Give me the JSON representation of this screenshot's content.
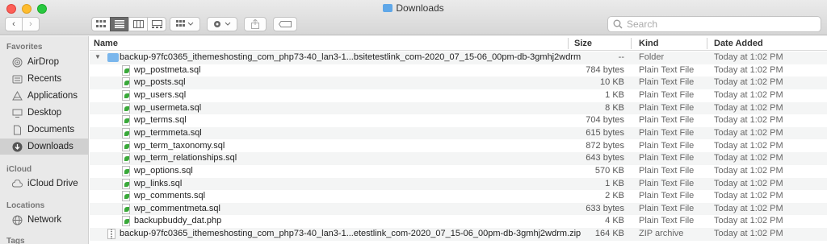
{
  "window": {
    "title": "Downloads"
  },
  "toolbar": {
    "back_glyph": "‹",
    "forward_glyph": "›",
    "search_placeholder": "Search"
  },
  "sidebar": {
    "favorites_heading": "Favorites",
    "favorites": [
      {
        "label": "AirDrop",
        "icon": "airdrop-icon"
      },
      {
        "label": "Recents",
        "icon": "recents-icon"
      },
      {
        "label": "Applications",
        "icon": "applications-icon"
      },
      {
        "label": "Desktop",
        "icon": "desktop-icon"
      },
      {
        "label": "Documents",
        "icon": "documents-icon"
      },
      {
        "label": "Downloads",
        "icon": "downloads-icon",
        "selected": true
      }
    ],
    "icloud_heading": "iCloud",
    "icloud": [
      {
        "label": "iCloud Drive",
        "icon": "cloud-icon"
      }
    ],
    "locations_heading": "Locations",
    "locations": [
      {
        "label": "Network",
        "icon": "network-icon"
      }
    ],
    "tags_heading": "Tags"
  },
  "columns": {
    "name": "Name",
    "size": "Size",
    "kind": "Kind",
    "date": "Date Added"
  },
  "rows": [
    {
      "name": "backup-97fc0365_ithemeshosting_com_php73-40_lan3-1...bsitetestlink_com-2020_07_15-06_00pm-db-3gmhj2wdrm",
      "size": "--",
      "kind": "Folder",
      "date": "Today at 1:02 PM",
      "type": "folder",
      "expanded": true
    },
    {
      "name": "wp_postmeta.sql",
      "size": "784 bytes",
      "kind": "Plain Text File",
      "date": "Today at 1:02 PM",
      "type": "sql"
    },
    {
      "name": "wp_posts.sql",
      "size": "10 KB",
      "kind": "Plain Text File",
      "date": "Today at 1:02 PM",
      "type": "sql"
    },
    {
      "name": "wp_users.sql",
      "size": "1 KB",
      "kind": "Plain Text File",
      "date": "Today at 1:02 PM",
      "type": "sql"
    },
    {
      "name": "wp_usermeta.sql",
      "size": "8 KB",
      "kind": "Plain Text File",
      "date": "Today at 1:02 PM",
      "type": "sql"
    },
    {
      "name": "wp_terms.sql",
      "size": "704 bytes",
      "kind": "Plain Text File",
      "date": "Today at 1:02 PM",
      "type": "sql"
    },
    {
      "name": "wp_termmeta.sql",
      "size": "615 bytes",
      "kind": "Plain Text File",
      "date": "Today at 1:02 PM",
      "type": "sql"
    },
    {
      "name": "wp_term_taxonomy.sql",
      "size": "872 bytes",
      "kind": "Plain Text File",
      "date": "Today at 1:02 PM",
      "type": "sql"
    },
    {
      "name": "wp_term_relationships.sql",
      "size": "643 bytes",
      "kind": "Plain Text File",
      "date": "Today at 1:02 PM",
      "type": "sql"
    },
    {
      "name": "wp_options.sql",
      "size": "570 KB",
      "kind": "Plain Text File",
      "date": "Today at 1:02 PM",
      "type": "sql"
    },
    {
      "name": "wp_links.sql",
      "size": "1 KB",
      "kind": "Plain Text File",
      "date": "Today at 1:02 PM",
      "type": "sql"
    },
    {
      "name": "wp_comments.sql",
      "size": "2 KB",
      "kind": "Plain Text File",
      "date": "Today at 1:02 PM",
      "type": "sql"
    },
    {
      "name": "wp_commentmeta.sql",
      "size": "633 bytes",
      "kind": "Plain Text File",
      "date": "Today at 1:02 PM",
      "type": "sql"
    },
    {
      "name": "backupbuddy_dat.php",
      "size": "4 KB",
      "kind": "Plain Text File",
      "date": "Today at 1:02 PM",
      "type": "php"
    },
    {
      "name": "backup-97fc0365_ithemeshosting_com_php73-40_lan3-1...etestlink_com-2020_07_15-06_00pm-db-3gmhj2wdrm.zip",
      "size": "164 KB",
      "kind": "ZIP archive",
      "date": "Today at 1:02 PM",
      "type": "zip"
    }
  ]
}
